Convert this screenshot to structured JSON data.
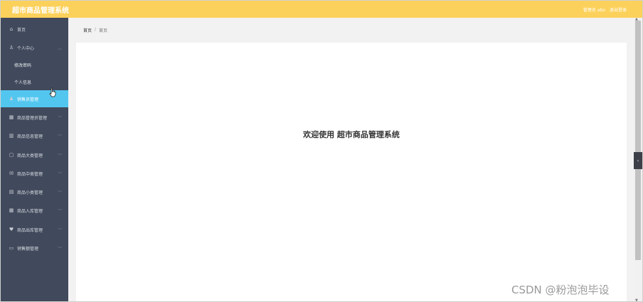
{
  "header": {
    "app_title": "超市商品管理系统",
    "user_label": "管理员 abo",
    "logout_label": "退出登录"
  },
  "sidebar": {
    "items": [
      {
        "label": "首页",
        "icon": "home-icon",
        "expandable": false
      },
      {
        "label": "个人中心",
        "icon": "user-icon",
        "expandable": true,
        "expanded": true
      },
      {
        "label": "修改密码",
        "sub": true
      },
      {
        "label": "个人信息",
        "sub": true
      },
      {
        "label": "销售员管理",
        "icon": "person-icon",
        "expandable": false,
        "active": true
      },
      {
        "label": "商品管理员管理",
        "icon": "grid-icon",
        "expandable": true
      },
      {
        "label": "商品信息管理",
        "icon": "bar-chart-icon",
        "expandable": true
      },
      {
        "label": "商品大类管理",
        "icon": "box-icon",
        "expandable": true
      },
      {
        "label": "商品中类管理",
        "icon": "mail-icon",
        "expandable": true
      },
      {
        "label": "商品小类管理",
        "icon": "chart-icon",
        "expandable": true
      },
      {
        "label": "商品入库管理",
        "icon": "table-icon",
        "expandable": true
      },
      {
        "label": "商品出库管理",
        "icon": "pin-icon",
        "expandable": true
      },
      {
        "label": "销售额管理",
        "icon": "card-icon",
        "expandable": true
      }
    ]
  },
  "breadcrumb": {
    "home": "首页",
    "separator": "/",
    "current": "首页"
  },
  "main": {
    "welcome": "欢迎使用 超市商品管理系统"
  },
  "watermark": "CSDN @粉泡泡毕设",
  "colors": {
    "topbar": "#fcd15b",
    "sidebar": "#414a5c",
    "active": "#53c6ef"
  }
}
